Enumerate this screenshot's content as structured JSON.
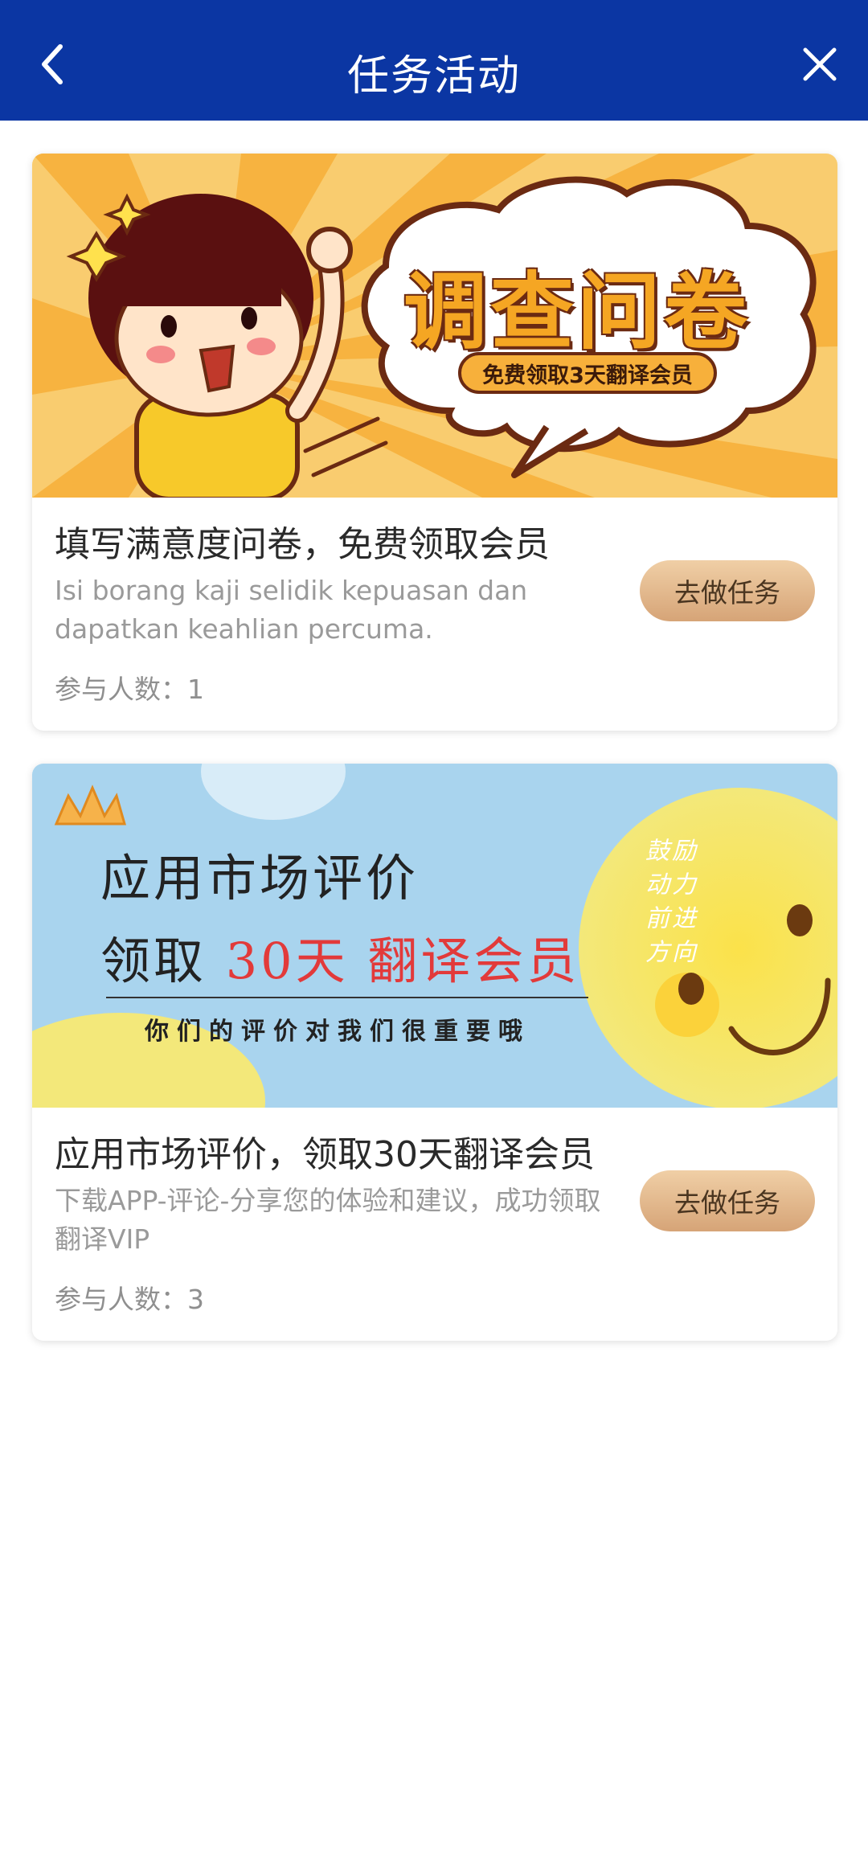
{
  "header": {
    "title": "任务活动",
    "back_icon": "chevron-left-icon",
    "close_icon": "close-icon",
    "background": "#0b36a3"
  },
  "tasks": [
    {
      "banner": {
        "headline": "调查问卷",
        "badge": "免费领取3天翻译会员"
      },
      "title": "填写满意度问卷，免费领取会员",
      "description": "Isi borang kaji selidik kepuasan dan dapatkan keahlian percuma.",
      "count": "参与人数：1",
      "button": "去做任务"
    },
    {
      "banner": {
        "line1": "应用市场评价",
        "line2_prefix": "领取 ",
        "line2_highlight": "30天  翻译会员",
        "note": "你们的评价对我们很重要哦",
        "vertical_left": "鼓动前方",
        "vertical_right": "励力进向"
      },
      "title": "应用市场评价，领取30天翻译会员",
      "description": "下载APP-评论-分享您的体验和建议，成功领取翻译VIP",
      "count": "参与人数：3",
      "button": "去做任务"
    }
  ],
  "colors": {
    "button_gradient_top": "#f0cfa6",
    "button_gradient_bottom": "#d6a477",
    "highlight_red": "#e23a3a"
  }
}
